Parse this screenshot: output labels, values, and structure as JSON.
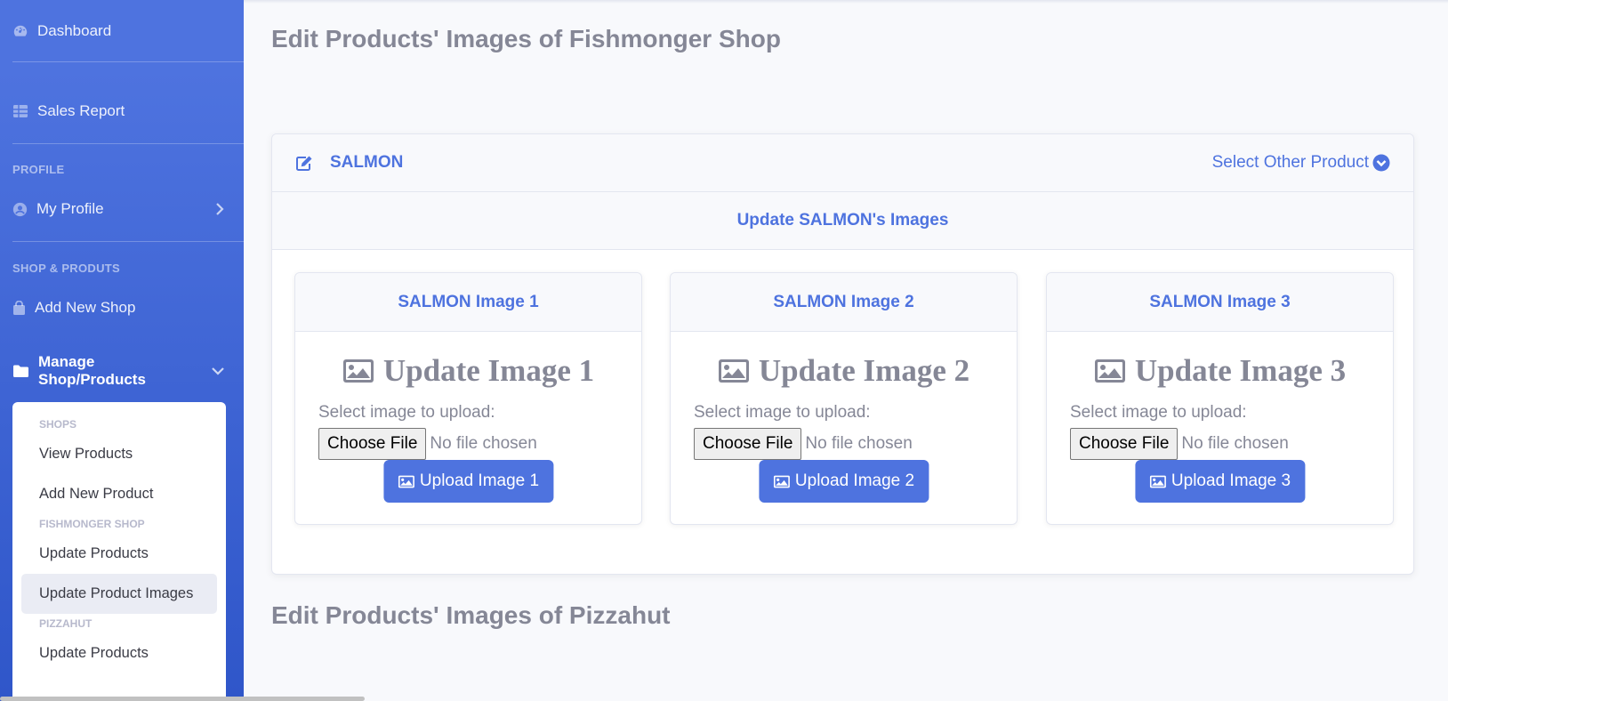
{
  "sidebar": {
    "dashboard": "Dashboard",
    "sales_report": "Sales Report",
    "heading_profile": "PROFILE",
    "my_profile": "My Profile",
    "heading_shop": "SHOP & PRODUTS",
    "add_new_shop": "Add New Shop",
    "manage": "Manage Shop/Products",
    "submenu": {
      "shops_header": "SHOPS",
      "view_products": "View Products",
      "add_new_product": "Add New Product",
      "fish_header": "FISHMONGER SHOP",
      "update_products": "Update Products",
      "update_product_images": "Update Product Images",
      "pizza_header": "PIZZAHUT",
      "update_products_2": "Update Products"
    }
  },
  "main": {
    "title": "Edit Products' Images of Fishmonger Shop",
    "title2": "Edit Products' Images of Pizzahut",
    "card": {
      "product_name": "SALMON",
      "select_other": "Select Other Product",
      "sub_header": "Update SALMON's Images",
      "images": [
        {
          "header": "SALMON Image 1",
          "title": "Update Image 1",
          "label": "Select image to upload:",
          "choose": "Choose File",
          "status": "No file chosen",
          "upload": "Upload Image 1"
        },
        {
          "header": "SALMON Image 2",
          "title": "Update Image 2",
          "label": "Select image to upload:",
          "choose": "Choose File",
          "status": "No file chosen",
          "upload": "Upload Image 2"
        },
        {
          "header": "SALMON Image 3",
          "title": "Update Image 3",
          "label": "Select image to upload:",
          "choose": "Choose File",
          "status": "No file chosen",
          "upload": "Upload Image 3"
        }
      ]
    }
  },
  "colors": {
    "primary": "#4e73df",
    "text_gray": "#858796",
    "bg": "#f8f9fc"
  },
  "icons": [
    "dashboard-icon",
    "table-icon",
    "user-circle-icon",
    "chevron-right-icon",
    "shopping-bag-icon",
    "folder-icon",
    "chevron-down-icon",
    "edit-icon",
    "chevron-circle-down-icon",
    "image-icon"
  ]
}
